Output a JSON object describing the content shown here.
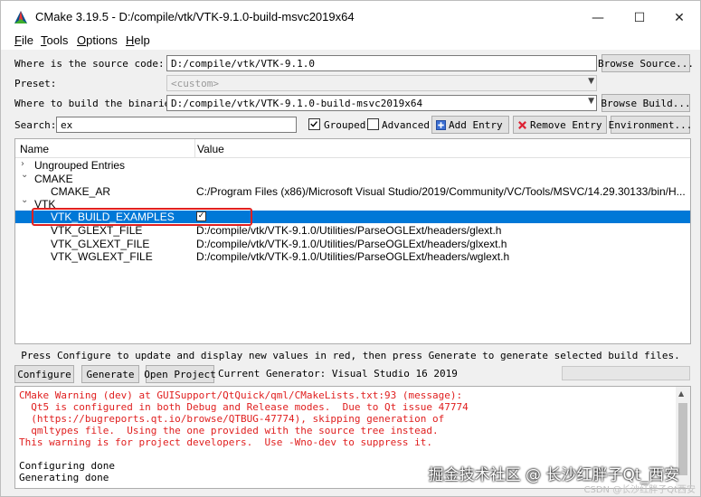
{
  "window": {
    "title": "CMake 3.19.5 - D:/compile/vtk/VTK-9.1.0-build-msvc2019x64",
    "minimize": "—",
    "maximize": "☐",
    "close": "✕"
  },
  "menu": [
    {
      "hot": "F",
      "rest": "ile"
    },
    {
      "hot": "T",
      "rest": "ools"
    },
    {
      "hot": "O",
      "rest": "ptions"
    },
    {
      "hot": "H",
      "rest": "elp"
    }
  ],
  "source": {
    "label": "Where is the source code:",
    "value": "D:/compile/vtk/VTK-9.1.0",
    "browse": "Browse Source..."
  },
  "preset": {
    "label": "Preset:",
    "value": "<custom>"
  },
  "build": {
    "label": "Where to build the binaries:",
    "value": "D:/compile/vtk/VTK-9.1.0-build-msvc2019x64",
    "browse": "Browse Build..."
  },
  "search": {
    "label": "Search:",
    "value": "ex"
  },
  "options": {
    "grouped": "Grouped",
    "grouped_checked": true,
    "advanced": "Advanced",
    "advanced_checked": false,
    "add_entry": "Add Entry",
    "remove_entry": "Remove Entry",
    "environment": "Environment..."
  },
  "tree": {
    "columns": {
      "name": "Name",
      "value": "Value"
    },
    "rows": [
      {
        "name": "Ungrouped Entries",
        "value": "",
        "arrow": "›"
      },
      {
        "name": "CMAKE",
        "value": "",
        "arrow": "⌄"
      },
      {
        "name": "CMAKE_AR",
        "value": "C:/Program Files (x86)/Microsoft Visual Studio/2019/Community/VC/Tools/MSVC/14.29.30133/bin/H..."
      },
      {
        "name": "VTK",
        "value": "",
        "arrow": "⌄"
      },
      {
        "name": "VTK_BUILD_EXAMPLES",
        "value": "✓",
        "selected": true
      },
      {
        "name": "VTK_GLEXT_FILE",
        "value": "D:/compile/vtk/VTK-9.1.0/Utilities/ParseOGLExt/headers/glext.h"
      },
      {
        "name": "VTK_GLXEXT_FILE",
        "value": "D:/compile/vtk/VTK-9.1.0/Utilities/ParseOGLExt/headers/glxext.h"
      },
      {
        "name": "VTK_WGLEXT_FILE",
        "value": "D:/compile/vtk/VTK-9.1.0/Utilities/ParseOGLExt/headers/wglext.h"
      }
    ]
  },
  "status_text": "Press Configure to update and display new values in red, then press Generate to generate selected build files.",
  "actions": {
    "configure": "Configure",
    "generate": "Generate",
    "open_project": "Open Project",
    "generator": "Current Generator: Visual Studio 16 2019"
  },
  "output": [
    {
      "text": "CMake Warning (dev) at GUISupport/QtQuick/qml/CMakeLists.txt:93 (message):",
      "red": true
    },
    {
      "text": "  Qt5 is configured in both Debug and Release modes.  Due to Qt issue 47774",
      "red": true
    },
    {
      "text": "  (https://bugreports.qt.io/browse/QTBUG-47774), skipping generation of",
      "red": true
    },
    {
      "text": "  qmltypes file.  Using the one provided with the source tree instead.",
      "red": true
    },
    {
      "text": "This warning is for project developers.  Use -Wno-dev to suppress it.",
      "red": true
    },
    {
      "text": "",
      "red": false
    },
    {
      "text": "Configuring done",
      "red": false
    },
    {
      "text": "Generating done",
      "red": false
    }
  ],
  "watermark": {
    "main": "掘金技术社区 @ 长沙红胖子Qt_西安",
    "sub": "CSDN @长沙红胖子Qt西安"
  }
}
